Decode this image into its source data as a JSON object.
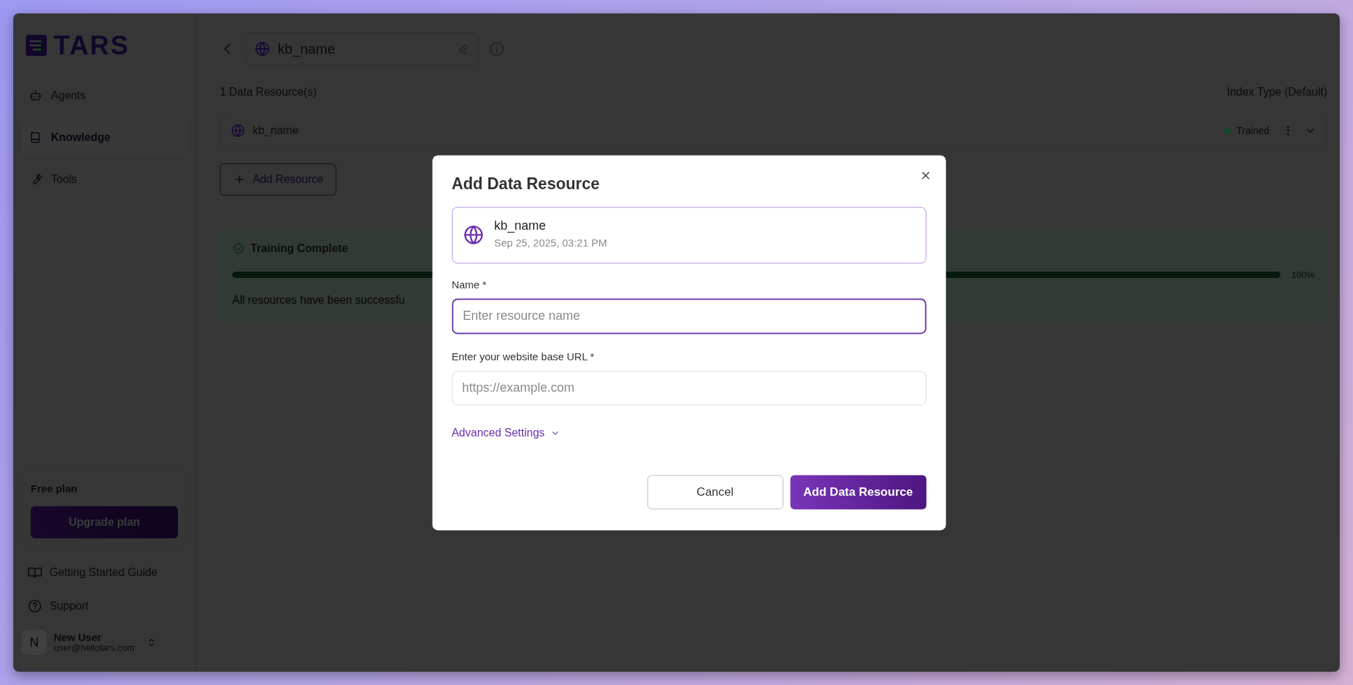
{
  "brand": {
    "name": "TARS"
  },
  "sidebar": {
    "items": [
      {
        "label": "Agents",
        "selected": false
      },
      {
        "label": "Knowledge",
        "selected": true
      },
      {
        "label": "Tools",
        "selected": false
      }
    ],
    "plan": {
      "title": "Free plan",
      "button": "Upgrade plan"
    },
    "links": [
      {
        "label": "Getting Started Guide"
      },
      {
        "label": "Support"
      }
    ],
    "user": {
      "initial": "N",
      "name": "New User",
      "email": "user@hellotars.com"
    }
  },
  "header": {
    "title": "kb_name"
  },
  "resources": {
    "count_label": "1 Data Resource(s)",
    "index_type": "Index Type (Default)",
    "items": [
      {
        "name": "kb_name",
        "status": "Trained",
        "color": "#0f4a26"
      }
    ],
    "add_button": "Add Resource"
  },
  "training": {
    "title": "Training Complete",
    "level": 1,
    "percent": "100%",
    "message": "All resources have been successfu"
  },
  "modal": {
    "title": "Add Data Resource",
    "source": {
      "name": "kb_name",
      "date": "Sep 25, 2025, 03:21 PM"
    },
    "fields": [
      {
        "label": "Name *",
        "placeholder": "Enter resource name",
        "focused": true
      },
      {
        "label": "Enter your website base URL *",
        "placeholder": "https://example.com",
        "focused": false
      }
    ],
    "advanced": "Advanced Settings",
    "cancel": "Cancel",
    "submit": "Add Data Resource"
  }
}
